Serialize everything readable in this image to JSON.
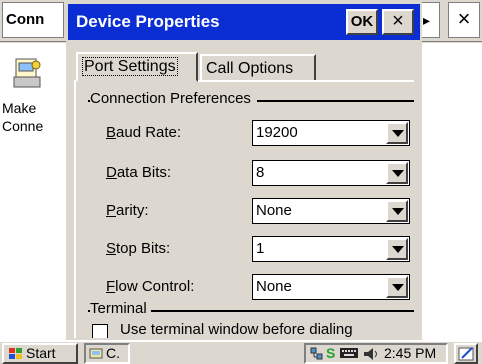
{
  "background_window": {
    "title": "Conn",
    "nav_glyph": "▸",
    "close_glyph": "×",
    "item_label": "Make\nConne"
  },
  "dialog": {
    "title": "Device Properties",
    "ok_label": "OK",
    "close_glyph": "×",
    "title_color": "#0a2dd4",
    "tabs": [
      {
        "label": "Port Settings",
        "selected": true
      },
      {
        "label": "Call Options",
        "selected": false
      }
    ],
    "group_connection": "Connection Preferences",
    "fields": [
      {
        "mnemonic": "B",
        "rest": "aud Rate:",
        "value": "19200"
      },
      {
        "mnemonic": "D",
        "rest": "ata Bits:",
        "value": "8"
      },
      {
        "mnemonic": "P",
        "rest": "arity:",
        "value": "None"
      },
      {
        "mnemonic": "S",
        "rest": "top Bits:",
        "value": "1"
      },
      {
        "mnemonic": "F",
        "rest": "low Control:",
        "value": "None"
      }
    ],
    "group_terminal": "Terminal",
    "terminal_checkbox_label": "Use terminal window before dialing"
  },
  "taskbar": {
    "start_label": "Start",
    "task_label": "C.",
    "tray_s": "S",
    "clock": "2:45 PM"
  }
}
